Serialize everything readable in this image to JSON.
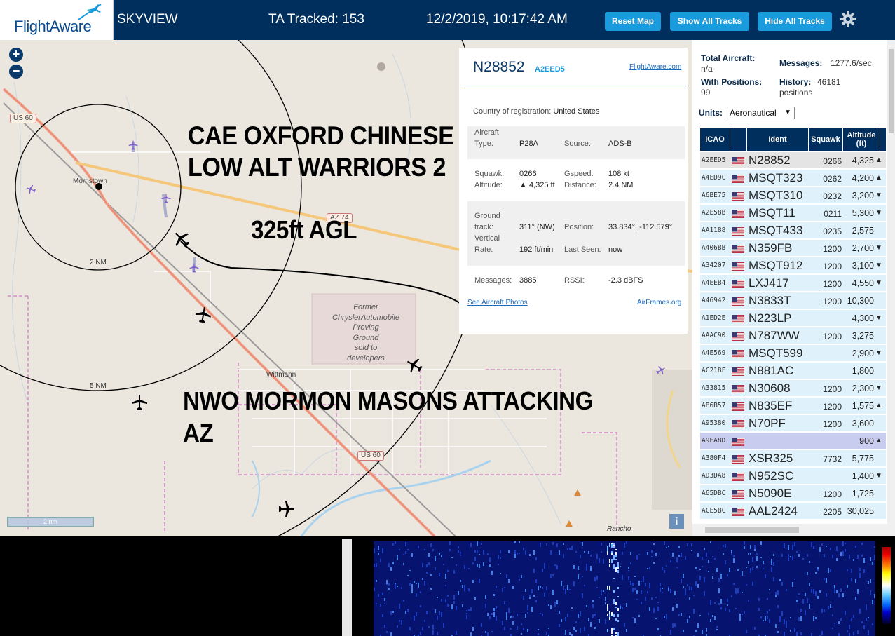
{
  "header": {
    "logo_text": "FlightAware",
    "title": "SKYVIEW",
    "tracked": "TA Tracked: 153",
    "datetime": "12/2/2019, 10:17:42 AM",
    "buttons": {
      "reset": "Reset Map",
      "show_all": "Show All Tracks",
      "hide_all": "Hide All Tracks"
    },
    "colors": {
      "bar": "#002f5d",
      "button": "#1a9bdd"
    }
  },
  "map": {
    "zoom_in": "+",
    "zoom_out": "−",
    "scale": "2 nm",
    "info": "i",
    "places": {
      "morristown": "Morristown",
      "wittmann": "Wittmann",
      "rancho": "Rancho"
    },
    "range_labels": {
      "inner": "2 NM",
      "outer": "5 NM"
    },
    "shields": {
      "us60_top": "US 60",
      "az74": "AZ 74",
      "us60_bottom": "US 60"
    },
    "proving_ground": [
      "Former",
      "ChryslerAutomobile",
      "Proving",
      "Ground",
      "sold to",
      "developers"
    ],
    "overlay": {
      "line1": "CAE OXFORD CHINESE",
      "line2": "LOW ALT WARRIORS 2",
      "agl": "325ft AGL",
      "nwo1": "NWO MORMON MASONS ATTACKING",
      "nwo2": "AZ"
    }
  },
  "popup": {
    "callsign": "N28852",
    "hex": "A2EED5",
    "link": "FlightAware.com",
    "country_label": "Country of registration:",
    "country": "United States",
    "aircraft_type_label_1": "Aircraft",
    "aircraft_type_label_2": "Type:",
    "aircraft_type": "P28A",
    "source_label": "Source:",
    "source": "ADS-B",
    "squawk_label": "Squawk:",
    "squawk": "0266",
    "gspeed_label": "Gspeed:",
    "gspeed": "108 kt",
    "altitude_label": "Altitude:",
    "altitude": "▲ 4,325 ft",
    "distance_label": "Distance:",
    "distance": "2.4 NM",
    "track_label_1": "Ground",
    "track_label_2": "track:",
    "track": "311° (NW)",
    "position_label": "Position:",
    "position": "33.834°, -112.579°",
    "vrate_label_1": "Vertical",
    "vrate_label_2": "Rate:",
    "vrate": "192 ft/min",
    "lastseen_label": "Last Seen:",
    "lastseen": "now",
    "messages_label": "Messages:",
    "messages": "3885",
    "rssi_label": "RSSI:",
    "rssi": "-2.3 dBFS",
    "photos_link": "See Aircraft Photos",
    "airframes_link": "AirFrames.org"
  },
  "sidebar": {
    "total_aircraft_label": "Total Aircraft:",
    "total_aircraft": "n/a",
    "messages_label": "Messages:",
    "messages": "1277.6/sec",
    "with_positions_label": "With Positions:",
    "with_positions": "99",
    "history_label": "History:",
    "history_1": "46181",
    "history_2": "positions",
    "units_label": "Units:",
    "units": "Aeronautical",
    "columns": {
      "icao": "ICAO",
      "ident": "Ident",
      "squawk": "Squawk",
      "altitude_1": "Altitude",
      "altitude_2": "(ft)"
    },
    "rows": [
      {
        "icao": "A2EED5",
        "ident": "N28852",
        "squawk": "0266",
        "alt": "4,325",
        "trend": "▲",
        "state": "sel"
      },
      {
        "icao": "A4ED9C",
        "ident": "MSQT323",
        "squawk": "0262",
        "alt": "4,200",
        "trend": "▲"
      },
      {
        "icao": "A6BE75",
        "ident": "MSQT310",
        "squawk": "0232",
        "alt": "3,200",
        "trend": "▼"
      },
      {
        "icao": "A2E58B",
        "ident": "MSQT11",
        "squawk": "0211",
        "alt": "5,300",
        "trend": "▼"
      },
      {
        "icao": "AA1188",
        "ident": "MSQT433",
        "squawk": "0235",
        "alt": "2,575",
        "trend": ""
      },
      {
        "icao": "A406BB",
        "ident": "N359FB",
        "squawk": "1200",
        "alt": "2,700",
        "trend": "▼"
      },
      {
        "icao": "A34207",
        "ident": "MSQT912",
        "squawk": "1200",
        "alt": "3,100",
        "trend": "▼"
      },
      {
        "icao": "A4EEB4",
        "ident": "LXJ417",
        "squawk": "1200",
        "alt": "4,550",
        "trend": "▼"
      },
      {
        "icao": "A46942",
        "ident": "N3833T",
        "squawk": "1200",
        "alt": "10,300",
        "trend": ""
      },
      {
        "icao": "A1ED2E",
        "ident": "N223LP",
        "squawk": "",
        "alt": "4,300",
        "trend": "▼"
      },
      {
        "icao": "AAAC90",
        "ident": "N787WW",
        "squawk": "1200",
        "alt": "3,275",
        "trend": ""
      },
      {
        "icao": "A4E569",
        "ident": "MSQT599",
        "squawk": "",
        "alt": "2,900",
        "trend": "▼"
      },
      {
        "icao": "AC218F",
        "ident": "N881AC",
        "squawk": "",
        "alt": "1,800",
        "trend": ""
      },
      {
        "icao": "A33815",
        "ident": "N30608",
        "squawk": "1200",
        "alt": "2,300",
        "trend": "▼"
      },
      {
        "icao": "AB6B57",
        "ident": "N835EF",
        "squawk": "1200",
        "alt": "1,575",
        "trend": "▲"
      },
      {
        "icao": "A95380",
        "ident": "N70PF",
        "squawk": "1200",
        "alt": "3,600",
        "trend": ""
      },
      {
        "icao": "A9EA8D",
        "ident": "",
        "squawk": "",
        "alt": "900",
        "trend": "▲",
        "state": "hl"
      },
      {
        "icao": "A380F4",
        "ident": "XSR325",
        "squawk": "7732",
        "alt": "5,775",
        "trend": ""
      },
      {
        "icao": "AD3DA8",
        "ident": "N952SC",
        "squawk": "",
        "alt": "1,400",
        "trend": "▼"
      },
      {
        "icao": "A65DBC",
        "ident": "N5090E",
        "squawk": "1200",
        "alt": "1,725",
        "trend": ""
      },
      {
        "icao": "ACE5BC",
        "ident": "AAL2424",
        "squawk": "2205",
        "alt": "30,025",
        "trend": ""
      }
    ]
  },
  "icons": {
    "logo": "airplane-icon",
    "settings": "gear-icon",
    "flag": "us-flag-icon",
    "receiver": "receiver-dot-icon",
    "aircraft": "airplane-icon"
  }
}
